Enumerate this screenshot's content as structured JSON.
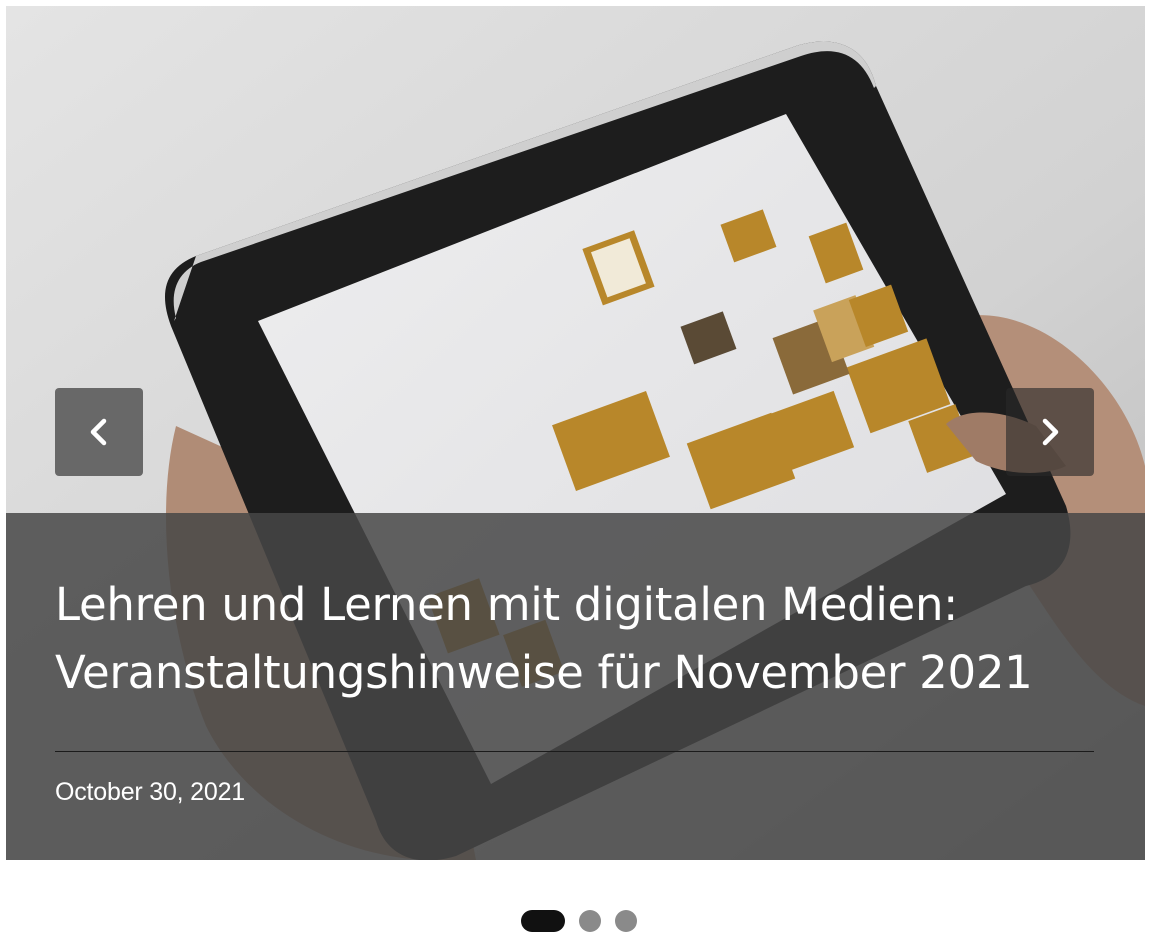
{
  "slider": {
    "image_alt": "Hands holding a tablet showing a document layout overview",
    "prev_icon": "chevron-left-icon",
    "next_icon": "chevron-right-icon",
    "active_index": 0,
    "slide_count": 3
  },
  "slide": {
    "title": "Lehren und Lernen mit digitalen Medien: Veranstaltungshinweise für November 2021",
    "date": "October 30, 2021"
  },
  "colors": {
    "caption_overlay": "#464646",
    "dot_active": "#111111",
    "dot_inactive": "#8a8a8a",
    "accent_gold": "#b8872a"
  }
}
